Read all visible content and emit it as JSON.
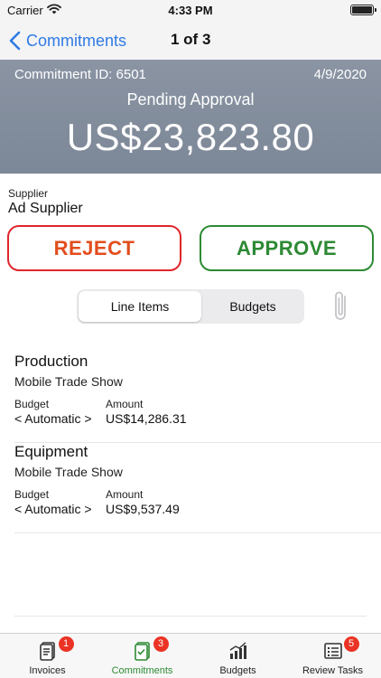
{
  "status_bar": {
    "carrier": "Carrier",
    "time": "4:33 PM"
  },
  "nav": {
    "back_label": "Commitments",
    "title": "1 of 3"
  },
  "header": {
    "commitment_id": "Commitment ID: 6501",
    "date": "4/9/2020",
    "status": "Pending Approval",
    "total": "US$23,823.80"
  },
  "supplier": {
    "label": "Supplier",
    "name": "Ad Supplier"
  },
  "actions": {
    "reject_label": "REJECT",
    "approve_label": "APPROVE",
    "reject_color": "#e0262c",
    "approve_color": "#2d8a34"
  },
  "segments": {
    "line_items": "Line Items",
    "budgets": "Budgets",
    "selected": "Line Items"
  },
  "line_items": [
    {
      "category": "Production",
      "description": "Mobile Trade Show",
      "budget_label": "Budget",
      "amount_label": "Amount",
      "budget": "< Automatic >",
      "amount": "US$14,286.31"
    },
    {
      "category": "Equipment",
      "description": "Mobile Trade Show",
      "budget_label": "Budget",
      "amount_label": "Amount",
      "budget": "< Automatic >",
      "amount": "US$9,537.49"
    }
  ],
  "tabbar": {
    "tabs": [
      {
        "label": "Invoices",
        "badge": "1",
        "icon": "invoices-icon"
      },
      {
        "label": "Commitments",
        "badge": "3",
        "icon": "commitments-icon",
        "active": true
      },
      {
        "label": "Budgets",
        "badge": "",
        "icon": "budgets-icon"
      },
      {
        "label": "Review Tasks",
        "badge": "5",
        "icon": "review-tasks-icon"
      }
    ],
    "active_color": "#2d8a34",
    "badge_color": "#ea3324"
  }
}
